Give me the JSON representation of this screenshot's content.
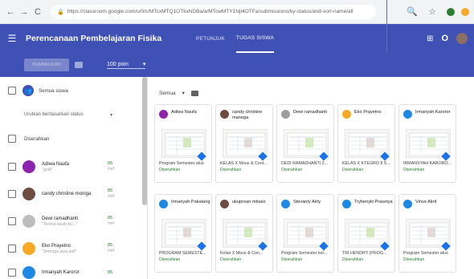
{
  "browser": {
    "url": "https://classroom.google.com/u/0/c/MTcxMTQ1OTkxNDBa/a/MTcwMTY1NjI4OTFa/submissions/by-status/and-sort-name/all"
  },
  "header": {
    "app_title": "Perencanaan Pembelajaran Fisika",
    "tabs": [
      {
        "label": "PETUNJUK"
      },
      {
        "label": "TUGAS SISWA"
      }
    ],
    "avatar_initial": "O"
  },
  "toolbar": {
    "return_label": "KEMBALIKAN",
    "points_label": "100 poin",
    "dropdown_arrow": "▾"
  },
  "sidebar": {
    "all_students_label": "Semua siswa",
    "sort_label": "Urutkan berdasarkan status",
    "section_label": "Diserahkan",
    "students": [
      {
        "name": "Adiwa Naufa",
        "sub": "\"gold\"",
        "grade": "85",
        "out": "/ref",
        "color": "#8e24aa"
      },
      {
        "name": "candy christine moniga",
        "sub": "",
        "grade": "85",
        "out": "/ref",
        "color": "#6d4c41"
      },
      {
        "name": "Dewi ramadhanti",
        "sub": "\"Terima kasih bu...\"",
        "grade": "85",
        "out": "/ref",
        "color": "#9e9e9e"
      },
      {
        "name": "Eko Prayetno",
        "sub": "\"Semoga jaya jadi\"",
        "grade": "85",
        "out": "/ref",
        "color": "#f9a825"
      },
      {
        "name": "Irmanyah Karoror",
        "sub": "",
        "grade": "85",
        "out": "/ref",
        "color": "#1e88e5"
      }
    ]
  },
  "main": {
    "filter_label": "Semua",
    "cards": [
      {
        "name": "Adiwa Naufa",
        "file": "Program Semester alus",
        "status": "Diserahkan",
        "color": "#8e24aa"
      },
      {
        "name": "candy christine manega",
        "file": "KELAS X Mous & Cont...",
        "status": "Diserahkan",
        "color": "#6d4c41"
      },
      {
        "name": "Dewi ramadhanti",
        "file": "DEDI RAMADHANTI 2...",
        "status": "Diserahkan",
        "color": "#9e9e9e"
      },
      {
        "name": "Eko Prayetno",
        "file": "KELAS X KTEGRO 8 S...",
        "status": "Diserahkan",
        "color": "#f9a825"
      },
      {
        "name": "Irmanyah Karoror",
        "file": "IRMANSYAH KARORO...",
        "status": "Diserahkan",
        "color": "#1e88e5"
      },
      {
        "name": "Irmanyah Pakatang",
        "file": "PROGRAM SEMESTE...",
        "status": "Diserahkan",
        "color": "#1e88e5"
      },
      {
        "name": "ukuproan mbaso",
        "file": "Kelas X Mous & Con...",
        "status": "Diserahkan",
        "color": "#6d4c41"
      },
      {
        "name": "Stevanty Airty",
        "file": "Program Semester kel...",
        "status": "Diserahkan",
        "color": "#1e88e5"
      },
      {
        "name": "Tryhenyki Prasetya",
        "file": "TRI HENDRY (PROG...",
        "status": "Diserahkan",
        "color": "#1e88e5"
      },
      {
        "name": "Vinus Alird",
        "file": "Program Semester alus",
        "status": "Diserahkan",
        "color": "#1e88e5"
      }
    ]
  }
}
